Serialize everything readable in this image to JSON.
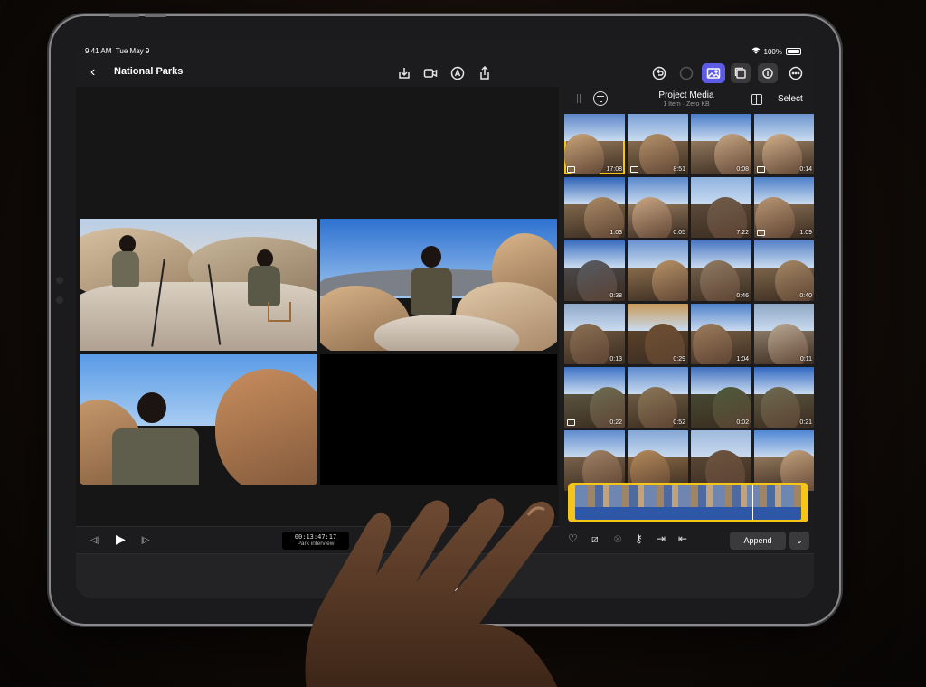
{
  "status": {
    "time": "9:41 AM",
    "date": "Tue May 9",
    "battery": "100%"
  },
  "navbar": {
    "title": "National Parks"
  },
  "browser": {
    "title": "Project Media",
    "subtitle": "1 Item  ·  Zero KB",
    "select_label": "Select",
    "thumbs": [
      {
        "dur": "17:08",
        "badge": true,
        "selected": true,
        "palette": [
          "#5d86c9",
          "#c9a47a"
        ]
      },
      {
        "dur": "8:51",
        "badge": true,
        "palette": [
          "#7aa0d6",
          "#b5926a"
        ]
      },
      {
        "dur": "0:08",
        "badge": false,
        "palette": [
          "#4a7cc9",
          "#c6a582"
        ]
      },
      {
        "dur": "0:14",
        "badge": true,
        "palette": [
          "#6c95cf",
          "#d0b08a"
        ]
      },
      {
        "dur": "1:03",
        "badge": false,
        "palette": [
          "#2f63b8",
          "#a98a66"
        ]
      },
      {
        "dur": "0:05",
        "badge": false,
        "palette": [
          "#5a88cc",
          "#caa784"
        ]
      },
      {
        "dur": "7:22",
        "badge": false,
        "palette": [
          "#8fb2e0",
          "#705c4b"
        ]
      },
      {
        "dur": "1:09",
        "badge": true,
        "palette": [
          "#4d7fc8",
          "#b99674"
        ]
      },
      {
        "dur": "0:38",
        "badge": false,
        "palette": [
          "#3a6ebf",
          "#555a63"
        ]
      },
      {
        "dur": "",
        "badge": false,
        "palette": [
          "#6a93d0",
          "#b69167"
        ]
      },
      {
        "dur": "0:46",
        "badge": false,
        "palette": [
          "#4876c2",
          "#8f7a63"
        ]
      },
      {
        "dur": "0:40",
        "badge": false,
        "palette": [
          "#5682c7",
          "#a48764"
        ]
      },
      {
        "dur": "0:13",
        "badge": false,
        "palette": [
          "#90a9c9",
          "#8b7055"
        ]
      },
      {
        "dur": "0:29",
        "badge": false,
        "palette": [
          "#c79a5a",
          "#6d4f31"
        ]
      },
      {
        "dur": "1:04",
        "badge": false,
        "palette": [
          "#4f82ca",
          "#9c7c5c"
        ]
      },
      {
        "dur": "0:11",
        "badge": false,
        "palette": [
          "#8fa7c4",
          "#b9a892"
        ]
      },
      {
        "dur": "0:22",
        "badge": true,
        "palette": [
          "#3c72c6",
          "#6e6c52"
        ]
      },
      {
        "dur": "0:52",
        "badge": false,
        "palette": [
          "#5d8ad0",
          "#8a7658"
        ]
      },
      {
        "dur": "0:02",
        "badge": false,
        "palette": [
          "#3e6fbf",
          "#4d5a3b"
        ]
      },
      {
        "dur": "0:21",
        "badge": false,
        "palette": [
          "#2f67c2",
          "#6c6a50"
        ]
      },
      {
        "dur": "",
        "badge": false,
        "palette": [
          "#5f8bcf",
          "#9f8164"
        ]
      },
      {
        "dur": "",
        "badge": false,
        "palette": [
          "#84a6d6",
          "#b38a5a"
        ]
      },
      {
        "dur": "",
        "badge": false,
        "palette": [
          "#9eb9dc",
          "#6b5440"
        ]
      },
      {
        "dur": "",
        "badge": false,
        "palette": [
          "#4f86d4",
          "#c3a17c"
        ]
      }
    ],
    "append_label": "Append"
  },
  "viewer": {
    "timecode": "00:13:47:17",
    "clip_name": "Park interview"
  },
  "colors": {
    "accent": "#5e5ce6",
    "selection": "#f5c518"
  }
}
